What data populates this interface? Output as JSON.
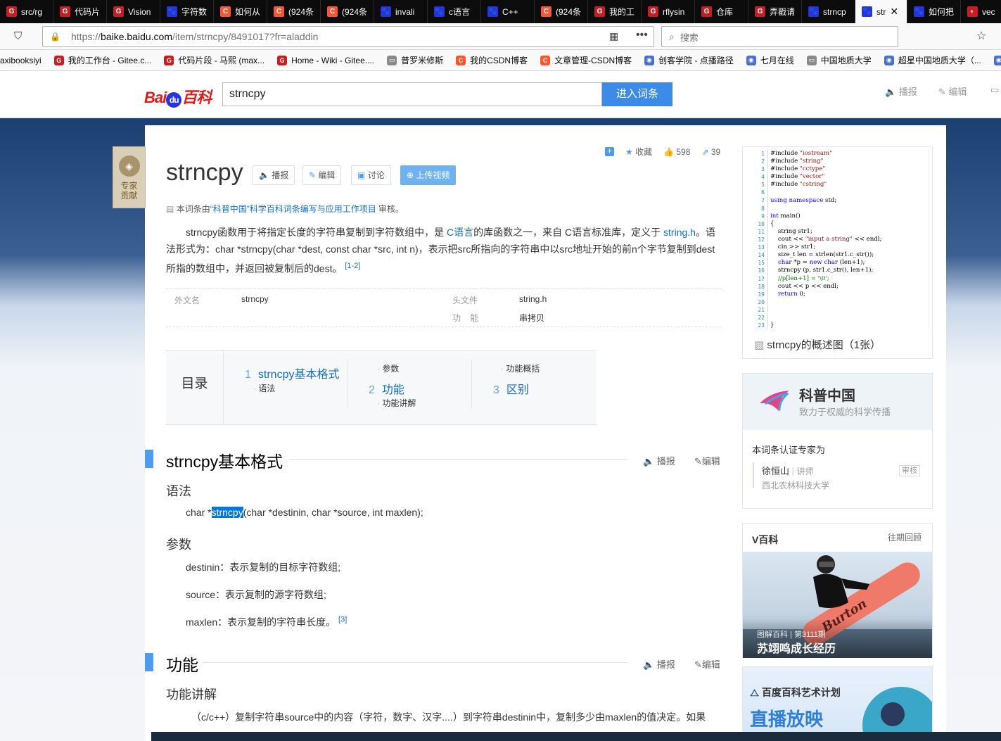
{
  "tabs": [
    {
      "label": "src/rg",
      "icon": "gitee-icon",
      "kind": "gitee"
    },
    {
      "label": "代码片",
      "icon": "gitee-icon",
      "kind": "gitee"
    },
    {
      "label": "Vision",
      "icon": "gitee-icon",
      "kind": "gitee"
    },
    {
      "label": "字符数",
      "icon": "baidu-icon",
      "kind": "baidu"
    },
    {
      "label": "如何从",
      "icon": "csdn-icon",
      "kind": "csdn"
    },
    {
      "label": "(924条",
      "icon": "csdn-icon",
      "kind": "csdn"
    },
    {
      "label": "(924条",
      "icon": "csdn-icon",
      "kind": "csdn"
    },
    {
      "label": "invali",
      "icon": "baidu-icon",
      "kind": "baidu"
    },
    {
      "label": "c语言",
      "icon": "baidu-icon",
      "kind": "baidu"
    },
    {
      "label": "C++",
      "icon": "baidu-icon",
      "kind": "baidu"
    },
    {
      "label": "(924条",
      "icon": "csdn-icon",
      "kind": "csdn"
    },
    {
      "label": "我的工",
      "icon": "gitee-icon",
      "kind": "gitee"
    },
    {
      "label": "rflysin",
      "icon": "gitee-icon",
      "kind": "gitee"
    },
    {
      "label": "仓库",
      "icon": "gitee-icon",
      "kind": "gitee"
    },
    {
      "label": "弄戳请",
      "icon": "gitee-icon",
      "kind": "gitee"
    },
    {
      "label": "strncp",
      "icon": "baidu-icon",
      "kind": "baidu"
    },
    {
      "label": "str",
      "icon": "baidu-icon",
      "kind": "baidu",
      "active": true
    },
    {
      "label": "如何把",
      "icon": "baidu-icon",
      "kind": "baidu"
    },
    {
      "label": "vec",
      "icon": "github-icon",
      "kind": "git"
    }
  ],
  "nav": {
    "url_prefix": "https://",
    "url_domain": "baike.baidu.com",
    "url_path": "/item/strncpy/8491017?fr=aladdin",
    "search_placeholder": "搜索"
  },
  "bookmarks": [
    {
      "label": "axibooksiyi",
      "kind": "none"
    },
    {
      "label": "我的工作台 - Gitee.c...",
      "kind": "gitee"
    },
    {
      "label": "代码片段 - 马熙 (max...",
      "kind": "gitee"
    },
    {
      "label": "Home - Wiki - Gitee....",
      "kind": "gitee"
    },
    {
      "label": "普罗米修斯",
      "kind": "folder"
    },
    {
      "label": "我的CSDN博客",
      "kind": "csdn"
    },
    {
      "label": "文章管理-CSDN博客",
      "kind": "csdn"
    },
    {
      "label": "创客学院 - 点播路径",
      "kind": "other"
    },
    {
      "label": "七月在线",
      "kind": "other"
    },
    {
      "label": "中国地质大学",
      "kind": "folder"
    },
    {
      "label": "超星中国地质大学（...",
      "kind": "other"
    },
    {
      "label": "学",
      "kind": "other"
    }
  ],
  "baike": {
    "logo_left": "Bai",
    "logo_du": "du",
    "logo_right": "百科",
    "search_value": "strncpy",
    "search_button": "进入词条",
    "header_links": [
      "播报",
      "编辑"
    ],
    "expert_label": "专家\n贡献"
  },
  "entry": {
    "title": "strncpy",
    "buttons": {
      "play": "播报",
      "edit": "编辑",
      "discuss": "讨论",
      "upload": "上传视频"
    },
    "toolline": {
      "collect": "收藏",
      "likes": "598",
      "shares": "39"
    },
    "audit_prefix": "本词条由",
    "audit_link": "“科普中国”科学百科词条编写与应用工作项目",
    "audit_suffix": " 审核。",
    "summary_1": "strncpy函数用于将指定长度的字符串复制到字符数组中，是 ",
    "summary_link1": "C语言",
    "summary_2": "的库函数之一，来自 C语言标准库，定义于 ",
    "summary_link2": "string.h",
    "summary_3": "。语法形式为：char *strncpy(char *dest, const char *src, int n)，表示把src所指向的字符串中以src地址开始的前n个字节复制到dest所指的数组中，并返回被复制后的dest。",
    "summary_ref": "[1-2]",
    "info": [
      {
        "k": "外文名",
        "v": "strncpy"
      },
      {
        "k": "头文件",
        "v": "string.h"
      },
      {
        "k": "功    能",
        "v": "串拷贝"
      }
    ],
    "catalog": {
      "head": "目录",
      "items": [
        {
          "n": "1",
          "label": "strncpy基本格式"
        },
        {
          "n": "2",
          "label": "功能"
        },
        {
          "n": "3",
          "label": "区别"
        }
      ],
      "subs": [
        "语法",
        "参数",
        "功能讲解",
        "功能概括"
      ]
    },
    "section1": {
      "title": "strncpy基本格式",
      "play": "播报",
      "edit": "编辑",
      "sub_syntax": "语法",
      "syntax_pre": "char *",
      "syntax_hl": "strncpy",
      "syntax_post": "(char *destinin, char *source, int maxlen);",
      "sub_params": "参数",
      "param1": "destinin：表示复制的目标字符数组;",
      "param2": "source：表示复制的源字符数组;",
      "param3": "maxlen：表示复制的字符串长度。",
      "param3_ref": "[3]"
    },
    "section2": {
      "title": "功能",
      "play": "播报",
      "edit": "编辑",
      "sub": "功能讲解",
      "para": "（c/c++）复制字符串source中的内容（字符，数字、汉字....）到字符串destinin中，复制多少由maxlen的值决定。如果"
    }
  },
  "sidebar": {
    "code_lines": [
      "1",
      "2",
      "3",
      "4",
      "5",
      "6",
      "7",
      "8",
      "9",
      "10",
      "11",
      "12",
      "13",
      "14",
      "15",
      "16",
      "17",
      "18",
      "19",
      "20",
      "21",
      "22",
      "23"
    ],
    "code_caption": "strncpy的概述图（1张）",
    "kp_name": "科普中国",
    "kp_slogan": "致力于权威的科学传播",
    "kp_cert": "本词条认证专家为",
    "expert_name": "徐恒山",
    "expert_title": "讲师",
    "expert_org": "西北农林科技大学",
    "expert_tag": "审核",
    "v_title": "V百科",
    "v_more": "往期回顾",
    "v_issue": "图解百科 | 第3111期",
    "v_caption": "苏翊鸣成长经历",
    "board_text": "Burton",
    "ad_brand": "百度百科艺术计划",
    "ad_title": "直播放映"
  }
}
